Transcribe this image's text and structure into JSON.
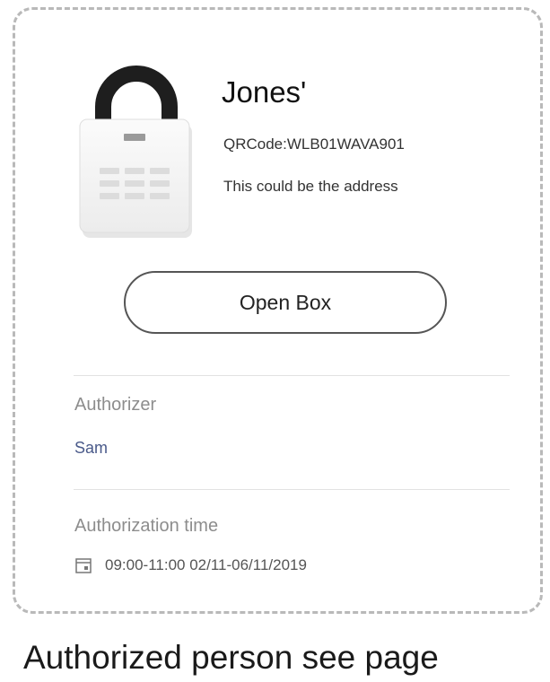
{
  "card": {
    "title": "Jones'",
    "qr_code": "QRCode:WLB01WAVA901",
    "address": "This could be the address",
    "open_button_label": "Open Box",
    "authorizer_label": "Authorizer",
    "authorizer_value": "Sam",
    "authorization_time_label": "Authorization time",
    "authorization_time_value": "09:00-11:00  02/11-06/11/2019"
  },
  "icons": {
    "lock": "padlock-icon",
    "calendar": "calendar-icon"
  },
  "caption": "Authorized person see page"
}
